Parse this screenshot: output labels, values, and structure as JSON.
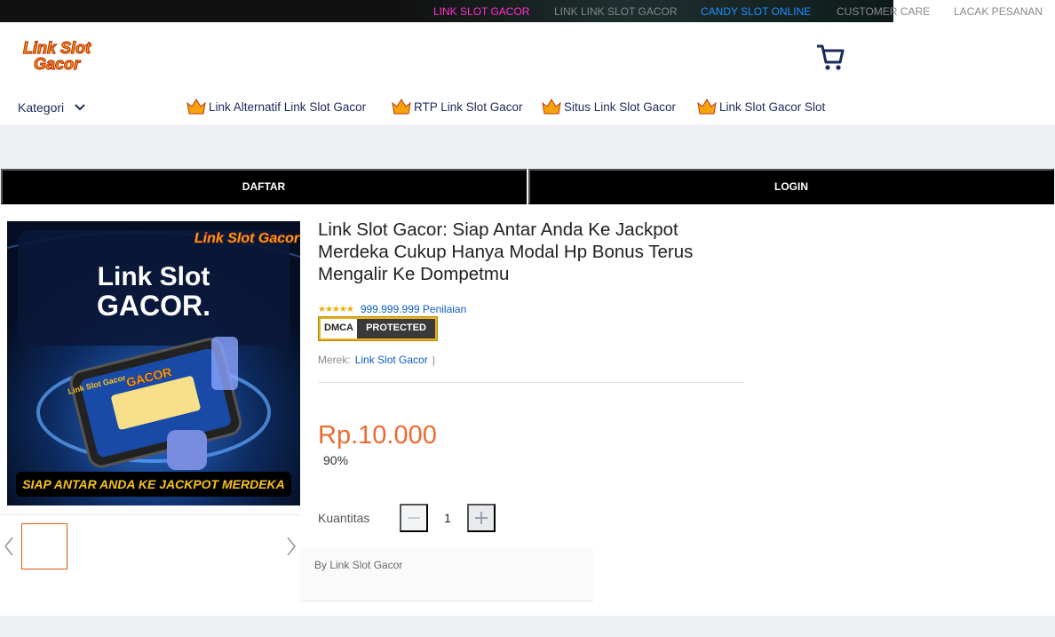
{
  "topbar": {
    "links": [
      {
        "label": "LINK SLOT GACOR",
        "color": "#ff2fd0"
      },
      {
        "label": "LINK LINK SLOT GACOR",
        "color": "#7e8a8a"
      },
      {
        "label": "CANDY SLOT ONLINE",
        "color": "#1e90ff"
      },
      {
        "label": "CUSTOMER CARE",
        "color": "#8a8a8a"
      },
      {
        "label": "LACAK PESANAN",
        "color": "#8a8a8a"
      }
    ]
  },
  "header": {
    "logo_text": "Link Slot Gacor",
    "cart_icon": "cart-icon"
  },
  "nav": {
    "kategori_label": "Kategori",
    "links": [
      "Link Alternatif Link Slot Gacor",
      "RTP Link Slot Gacor",
      "Situs Link Slot Gacor",
      "Link Slot Gacor Slot"
    ]
  },
  "actions": {
    "daftar_label": "DAFTAR",
    "login_label": "LOGIN"
  },
  "product": {
    "banner": {
      "corner_logo": "Link Slot Gacor",
      "headline_1": "Link Slot",
      "headline_2": "GACOR.",
      "phone_label": "Link Slot Gacor",
      "footer_text": "SIAP ANTAR ANDA KE JACKPOT MERDEKA"
    },
    "title": "Link Slot Gacor: Siap Antar Anda Ke Jackpot Merdeka Cukup Hanya Modal Hp Bonus Terus Mengalir Ke Dompetmu",
    "stars": "★★★★★",
    "rating_count": "999.999.999 Penilaian",
    "dmca_left": "DMCA",
    "dmca_right": "PROTECTED",
    "brand_label": "Merek:",
    "brand_value": "Link Slot Gacor",
    "brand_sep": "|",
    "price": "Rp.10.000",
    "discount": "90%",
    "quantity_label": "Kuantitas",
    "quantity_value": "1",
    "byline": "By Link Slot Gacor"
  },
  "colors": {
    "accent": "#ee6a2e",
    "link": "#0b5cc9",
    "nav_text": "#1c2a5a"
  }
}
